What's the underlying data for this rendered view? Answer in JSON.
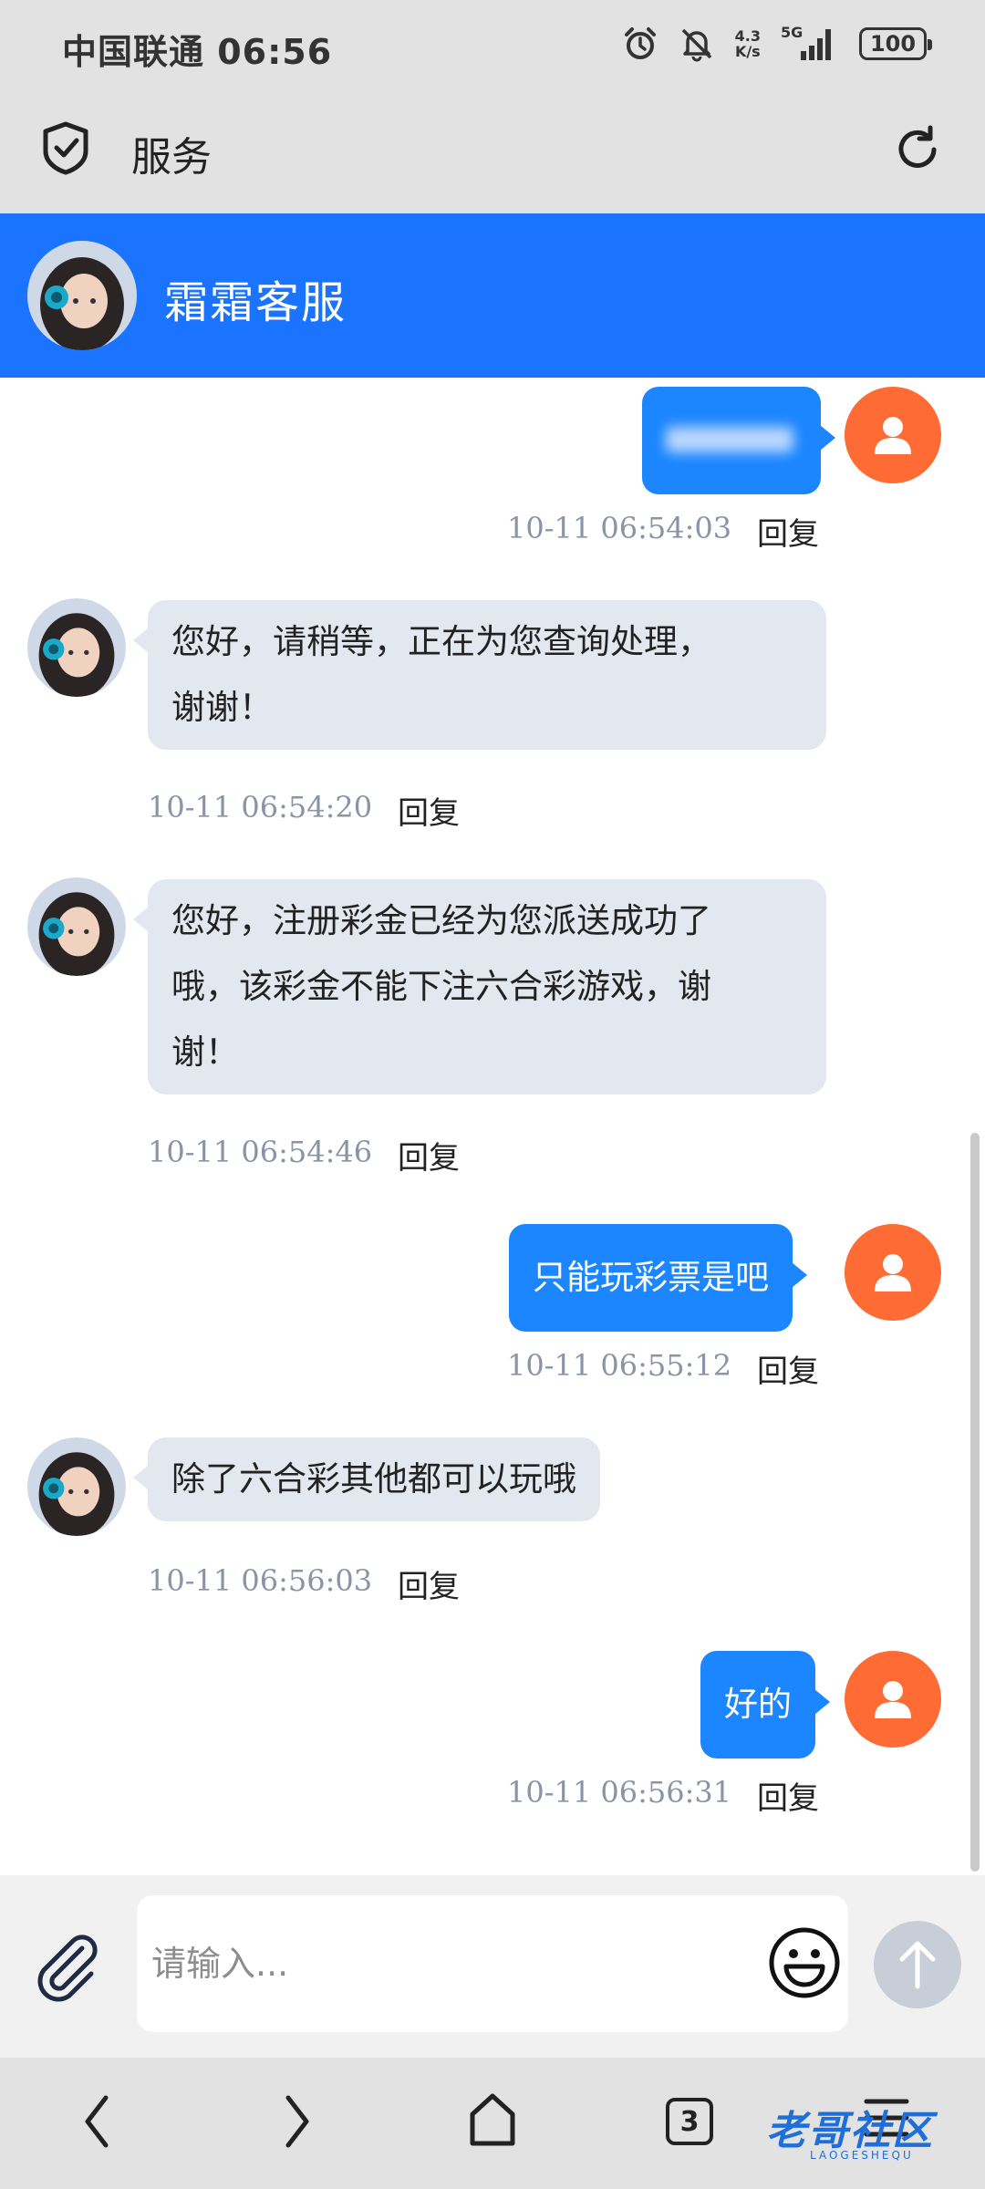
{
  "status_bar": {
    "carrier_time": "中国联通 06:56",
    "net_speed_value": "4.3",
    "net_speed_unit": "K/s",
    "network": "5G",
    "battery": "100",
    "icons": [
      "alarm-icon",
      "mute-icon",
      "signal-icon"
    ]
  },
  "app_bar": {
    "title": "服务",
    "icons": [
      "shield-check-icon",
      "refresh-icon"
    ]
  },
  "chat_header": {
    "name": "霜霜客服",
    "accent_color": "#1b74ff"
  },
  "messages": [
    {
      "side": "out",
      "text": "",
      "time": "10-11 06:54:03",
      "reply": "回复",
      "blurred": true
    },
    {
      "side": "in",
      "lines": [
        "您好，请稍等，正在为您查询处理，",
        "谢谢！"
      ],
      "time": "10-11 06:54:20",
      "reply": "回复"
    },
    {
      "side": "in",
      "lines": [
        "您好，注册彩金已经为您派送成功了",
        "哦，该彩金不能下注六合彩游戏，谢",
        "谢！"
      ],
      "time": "10-11 06:54:46",
      "reply": "回复"
    },
    {
      "side": "out",
      "text": "只能玩彩票是吧",
      "time": "10-11 06:55:12",
      "reply": "回复"
    },
    {
      "side": "in",
      "lines": [
        "除了六合彩其他都可以玩哦"
      ],
      "time": "10-11 06:56:03",
      "reply": "回复"
    },
    {
      "side": "out",
      "text": "好的",
      "time": "10-11 06:56:31",
      "reply": "回复"
    }
  ],
  "input_bar": {
    "placeholder": "请输入...",
    "icons": [
      "paperclip-icon",
      "emoji-icon",
      "send-arrow-icon"
    ]
  },
  "nav_bar": {
    "tab_count": "3",
    "watermark": "老哥社区",
    "watermark_sub": "LAOGESHEQU",
    "icons": [
      "back-icon",
      "forward-icon",
      "home-icon",
      "tabs-icon",
      "menu-icon"
    ]
  },
  "colors": {
    "outgoing_bubble": "#1b86ff",
    "incoming_bubble": "#e3e7ef",
    "user_avatar": "#ff6b35"
  }
}
